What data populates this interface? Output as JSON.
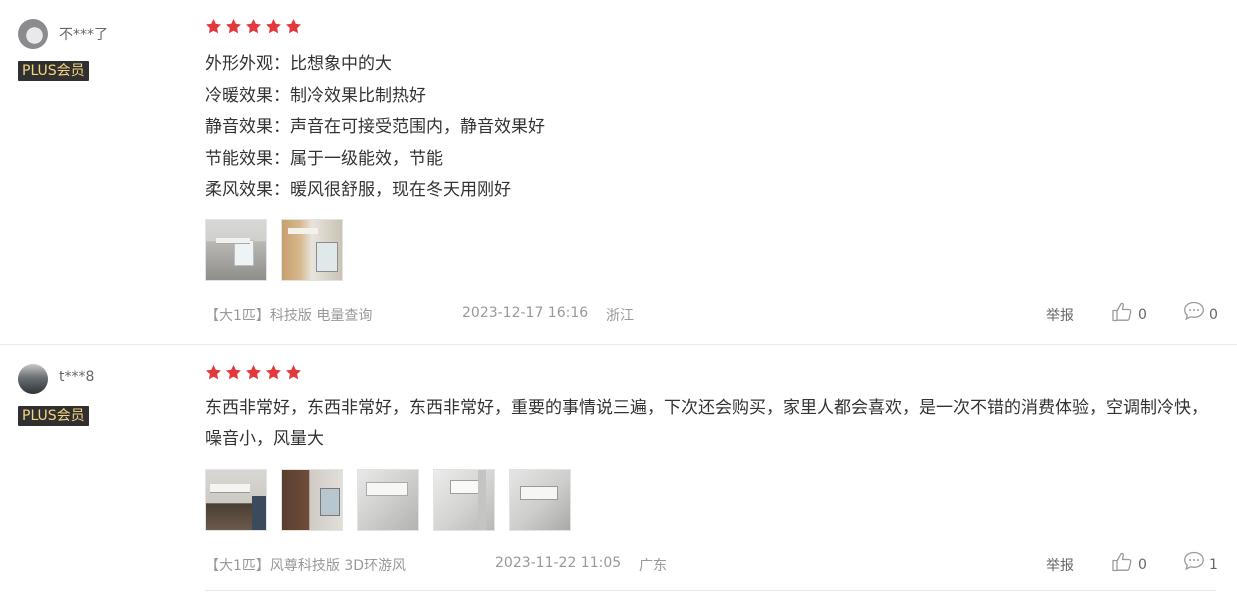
{
  "colors": {
    "star": "#e4393c",
    "badge_bg": "#303030",
    "badge_text": "#f5d680"
  },
  "reviews": [
    {
      "username": "不***了",
      "badge": "PLUS会员",
      "rating": 5,
      "lines": [
        "外形外观：比想象中的大",
        "冷暖效果：制冷效果比制热好",
        "静音效果：声音在可接受范围内，静音效果好",
        "节能效果：属于一级能效，节能",
        "柔风效果：暖风很舒服，现在冬天用刚好"
      ],
      "product": "【大1匹】科技版 电量查询",
      "date": "2023-12-17 16:16",
      "location": "浙江",
      "report": "举报",
      "likes": "0",
      "comments": "0"
    },
    {
      "username": "t***8",
      "badge": "PLUS会员",
      "rating": 5,
      "text": "东西非常好，东西非常好，东西非常好，重要的事情说三遍，下次还会购买，家里人都会喜欢，是一次不错的消费体验，空调制冷快，噪音小，风量大",
      "product": "【大1匹】风尊科技版 3D环游风",
      "date": "2023-11-22 11:05",
      "location": "广东",
      "report": "举报",
      "likes": "0",
      "comments": "1"
    }
  ]
}
